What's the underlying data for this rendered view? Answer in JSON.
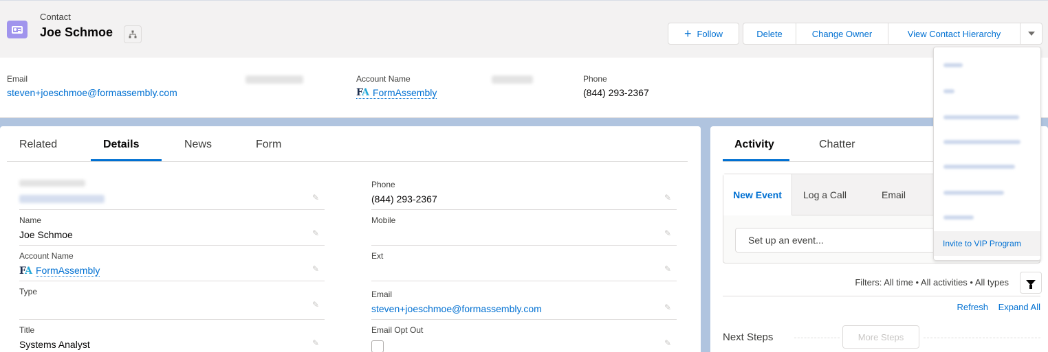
{
  "header": {
    "object_type": "Contact",
    "record_name": "Joe Schmoe",
    "buttons": {
      "follow": "Follow",
      "delete": "Delete",
      "change_owner": "Change Owner",
      "view_hierarchy": "View Contact Hierarchy"
    },
    "icons": {
      "object": "contact-card-icon",
      "hierarchy": "hierarchy-icon",
      "menu": "chevron-down-icon"
    }
  },
  "highlights": [
    {
      "label": "Email",
      "value": "steven+joeschmoe@formassembly.com"
    },
    {
      "label": "Account Name",
      "value": "FormAssembly"
    },
    {
      "label": "Phone",
      "value": "(844) 293-2367"
    }
  ],
  "details": {
    "tabs": [
      "Related",
      "Details",
      "News",
      "Form"
    ],
    "active_tab": "Details",
    "left_fields": [
      {
        "label": "Name",
        "value": "Joe Schmoe"
      },
      {
        "label": "Account Name",
        "value": "FormAssembly"
      },
      {
        "label": "Type",
        "value": ""
      },
      {
        "label": "Title",
        "value": "Systems Analyst"
      }
    ],
    "right_fields": [
      {
        "label": "Phone",
        "value": "(844) 293-2367"
      },
      {
        "label": "Mobile",
        "value": ""
      },
      {
        "label": "Ext",
        "value": ""
      },
      {
        "label": "Email",
        "value": "steven+joeschmoe@formassembly.com"
      },
      {
        "label": "Email Opt Out",
        "value": false
      }
    ]
  },
  "activity": {
    "tabs": [
      "Activity",
      "Chatter"
    ],
    "publisher_tabs": [
      "New Event",
      "Log a Call",
      "Email"
    ],
    "input_placeholder": "Set up an event...",
    "filters": "Filters: All time • All activities • All types",
    "refresh": "Refresh",
    "expand_all": "Expand All",
    "next_steps": "Next Steps",
    "more_steps": "More Steps"
  },
  "menu": {
    "visible_item": "Invite to VIP Program"
  },
  "logo": {
    "f": "F",
    "a": "A"
  },
  "colors": {
    "brand": "#0070d2",
    "contact_icon": "#a094ed",
    "background": "#b0c4df"
  }
}
